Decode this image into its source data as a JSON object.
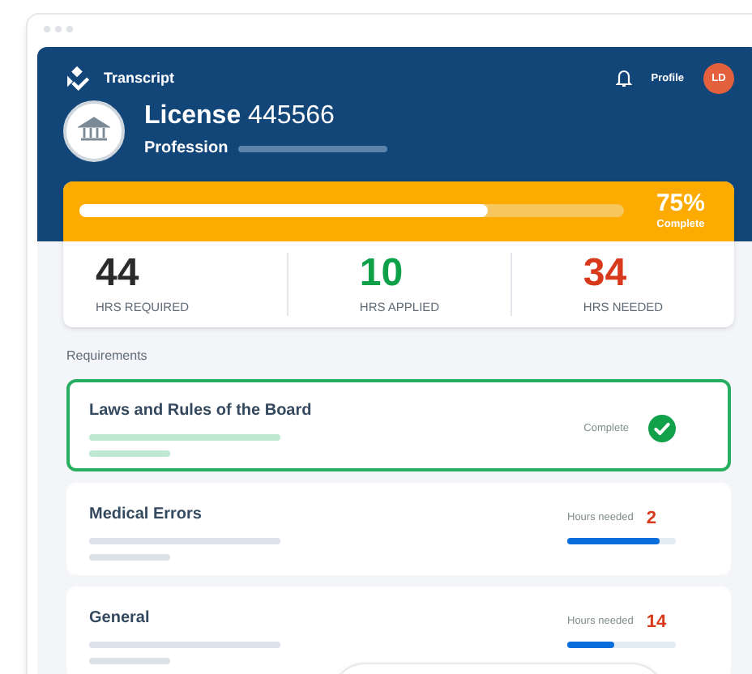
{
  "app": {
    "title": "Transcript",
    "profile_label": "Profile",
    "avatar_initials": "LD"
  },
  "license": {
    "label": "License",
    "number": "445566",
    "profession_label": "Profession"
  },
  "progress": {
    "level": 0.75,
    "percent": "75%",
    "caption": "Complete"
  },
  "stats": [
    {
      "value": "44",
      "label": "HRS REQUIRED",
      "color": "#2b2b2b"
    },
    {
      "value": "10",
      "label": "HRS APPLIED",
      "color": "#0fa14a"
    },
    {
      "value": "34",
      "label": "HRS NEEDED",
      "color": "#d8391b"
    }
  ],
  "requirements": {
    "heading": "Requirements",
    "items": [
      {
        "kind": "complete",
        "title": "Laws and Rules of the Board",
        "status": "Complete"
      },
      {
        "kind": "needed",
        "title": "Medical Errors",
        "status": "Hours needed",
        "hours": "2",
        "level": 0.85
      },
      {
        "kind": "needed",
        "title": "General",
        "status": "Hours needed",
        "hours": "14",
        "level": 0.44
      }
    ]
  }
}
